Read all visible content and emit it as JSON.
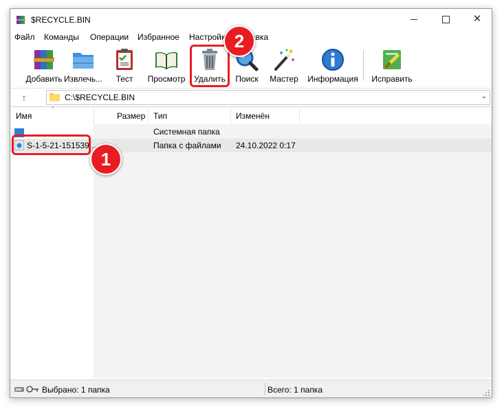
{
  "window": {
    "title": "$RECYCLE.BIN"
  },
  "menu": [
    "Файл",
    "Команды",
    "Операции",
    "Избранное",
    "Настройки",
    "Справка"
  ],
  "toolbar": [
    {
      "label": "Добавить",
      "icon": "archive-books-icon"
    },
    {
      "label": "Извлечь...",
      "icon": "extract-folder-icon"
    },
    {
      "label": "Тест",
      "icon": "test-clipboard-icon"
    },
    {
      "label": "Просмотр",
      "icon": "view-book-icon"
    },
    {
      "label": "Удалить",
      "icon": "trash-bin-icon"
    },
    {
      "label": "Поиск",
      "icon": "search-magnifier-icon"
    },
    {
      "label": "Мастер",
      "icon": "wizard-wand-icon"
    },
    {
      "label": "Информация",
      "icon": "info-icon"
    },
    {
      "label": "Исправить",
      "icon": "repair-icon"
    }
  ],
  "address": {
    "path": "C:\\$RECYCLE.BIN"
  },
  "columns": [
    "Имя",
    "Размер",
    "Тип",
    "Изменён"
  ],
  "rows": [
    {
      "name": "",
      "size": "",
      "type": "Системная папка",
      "modified": ""
    },
    {
      "name": "S-1-5-21-151539...",
      "size": "",
      "type": "Папка с файлами",
      "modified": "24.10.2022 0:17"
    }
  ],
  "status": {
    "selected": "Выбрано: 1 папка",
    "total": "Всего: 1 папка"
  },
  "annotations": {
    "step1": "1",
    "step2": "2"
  },
  "colors": {
    "annotation": "#e81d24",
    "folder_blue": "#2f80d0",
    "folder_yellow": "#f5c542"
  }
}
